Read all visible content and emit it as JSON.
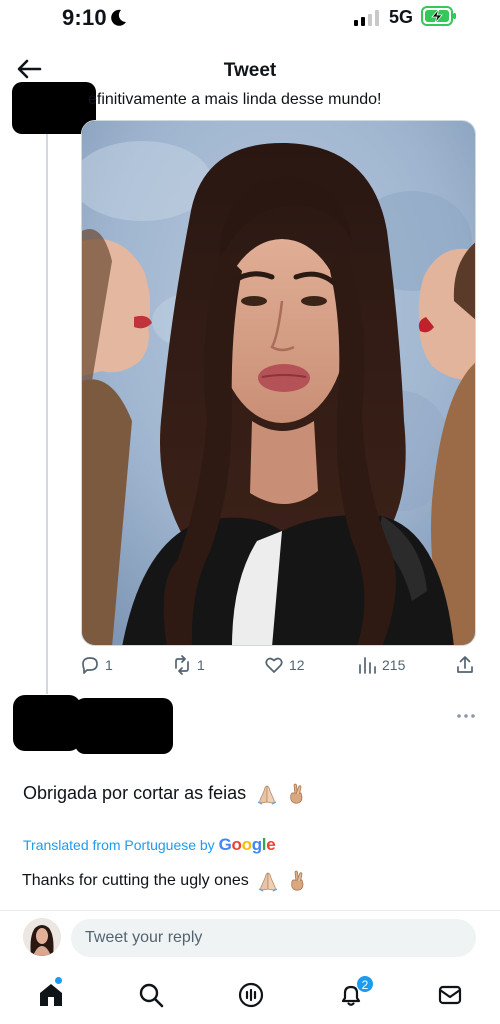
{
  "status_bar": {
    "time": "9:10",
    "network": "5G",
    "icons": [
      "moon-icon",
      "signal-icon",
      "battery-charging-icon"
    ]
  },
  "header": {
    "title": "Tweet",
    "back_icon": "arrow-left-icon"
  },
  "tweet": {
    "text": "efinitivamente a mais linda desse mundo!",
    "media": "photo",
    "actions": {
      "replies": "1",
      "retweets": "1",
      "likes": "12",
      "views": "215"
    }
  },
  "reply": {
    "text": "Obrigada por cortar as feias",
    "translated_label": "Translated from Portuguese by",
    "translated_brand": "Google",
    "translation": "Thanks for cutting the ugly ones",
    "emojis": [
      "praying-hands-emoji",
      "crossed-fingers-emoji"
    ]
  },
  "compose": {
    "placeholder": "Tweet your reply"
  },
  "bottom_nav": {
    "items": [
      "home-icon",
      "search-icon",
      "spaces-icon",
      "notifications-icon",
      "messages-icon"
    ],
    "notification_count": "2"
  },
  "colors": {
    "accent": "#1d9bf0",
    "text_primary": "#0f1419",
    "text_secondary": "#536471"
  }
}
